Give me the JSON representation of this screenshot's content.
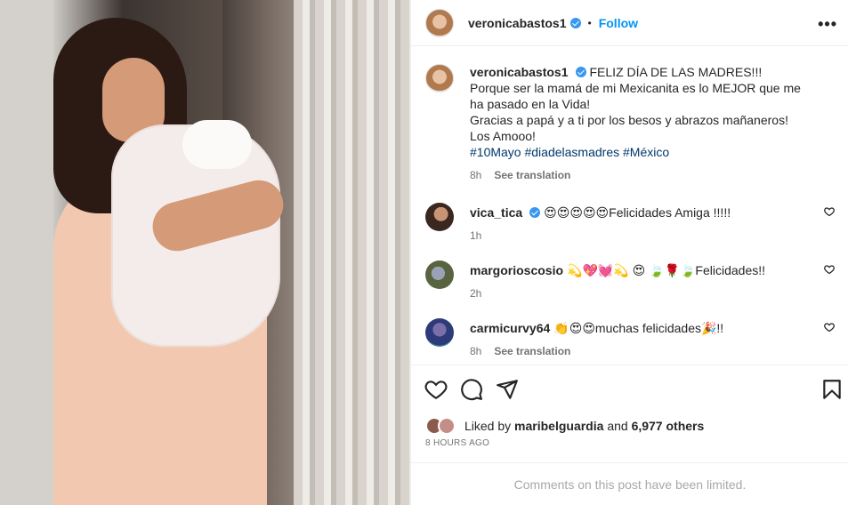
{
  "post": {
    "author": "veronicabastos1",
    "follow_label": "Follow",
    "dot": "•",
    "more": "•••",
    "caption_lines": [
      "FELIZ DÍA DE LAS MADRES!!!",
      "Porque ser la mamá de mi Mexicanita es lo MEJOR que me ha pasado en la Vida!",
      "Gracias a papá y a ti por los besos y abrazos mañaneros! Los Amooo!"
    ],
    "hashtags": "#10Mayo #diadelasmadres #México",
    "caption_time": "8h",
    "see_translation": "See translation"
  },
  "comments": [
    {
      "user": "vica_tica",
      "verified": true,
      "text": "😍😍😍😍😍Felicidades Amiga !!!!!",
      "time": "1h",
      "see_translation": ""
    },
    {
      "user": "margorioscosio",
      "verified": false,
      "text": "💫💖💓💫 😍 🍃🌹🍃Felicidades!!",
      "time": "2h",
      "see_translation": ""
    },
    {
      "user": "carmicurvy64",
      "verified": false,
      "text": "👏😍😍muchas felicidades🎉!!",
      "time": "8h",
      "see_translation": "See translation"
    }
  ],
  "likes": {
    "prefix": "Liked by",
    "liker": "maribelguardia",
    "and": "and",
    "others": "6,977 others"
  },
  "timestamp": "8 HOURS AGO",
  "limited_notice": "Comments on this post have been limited.",
  "colors": {
    "accent": "#0095f6",
    "verified": "#3897f0",
    "muted": "#737373",
    "hashtag": "#00376b"
  }
}
